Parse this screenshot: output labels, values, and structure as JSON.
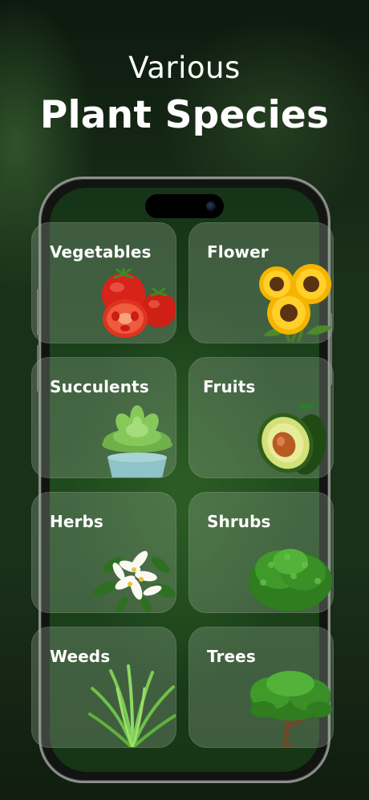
{
  "header": {
    "subtitle": "Various",
    "title": "Plant Species"
  },
  "categories": [
    {
      "label": "Vegetables",
      "icon": "tomato-icon"
    },
    {
      "label": "Flower",
      "icon": "sunflower-icon"
    },
    {
      "label": "Succulents",
      "icon": "succulent-icon"
    },
    {
      "label": "Fruits",
      "icon": "avocado-icon"
    },
    {
      "label": "Herbs",
      "icon": "white-flower-icon"
    },
    {
      "label": "Shrubs",
      "icon": "shrub-icon"
    },
    {
      "label": "Weeds",
      "icon": "grass-icon"
    },
    {
      "label": "Trees",
      "icon": "tree-icon"
    }
  ]
}
